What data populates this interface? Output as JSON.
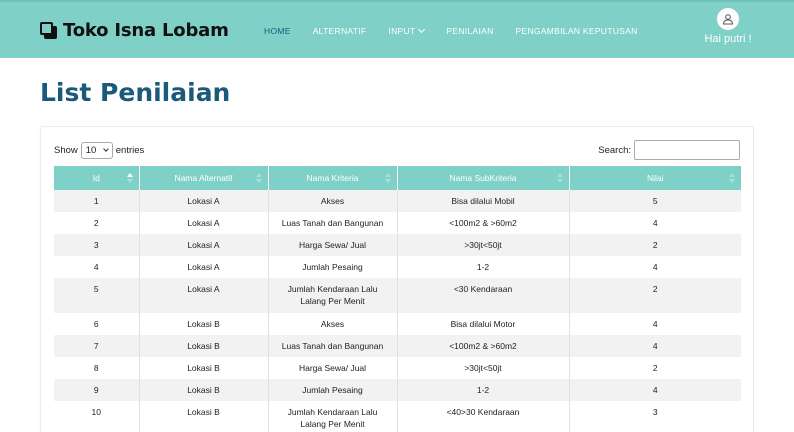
{
  "brand": {
    "name": "Toko Isna Lobam"
  },
  "nav": {
    "items": [
      {
        "label": "HOME",
        "active": true
      },
      {
        "label": "ALTERNATIF",
        "active": false
      },
      {
        "label": "INPUT",
        "active": false,
        "dropdown": true
      },
      {
        "label": "PENILAIAN",
        "active": false
      },
      {
        "label": "PENGAMBILAN KEPUTUSAN",
        "active": false
      }
    ]
  },
  "user": {
    "greeting": "Hai putri !",
    "icon": "user-icon"
  },
  "page": {
    "title": "List Penilaian"
  },
  "table_controls": {
    "show_label": "Show",
    "entries_value": "10",
    "entries_label": "entries",
    "search_label": "Search:",
    "search_value": ""
  },
  "table": {
    "columns": [
      "Id",
      "Nama Alternatif",
      "Nama Kriteria",
      "Nama SubKriteria",
      "Nilai"
    ],
    "rows": [
      [
        "1",
        "Lokasi A",
        "Akses",
        "Bisa dilalui Mobil",
        "5"
      ],
      [
        "2",
        "Lokasi A",
        "Luas Tanah dan Bangunan",
        "<100m2 & >60m2",
        "4"
      ],
      [
        "3",
        "Lokasi A",
        "Harga Sewa/ Jual",
        ">30jt<50jt",
        "2"
      ],
      [
        "4",
        "Lokasi A",
        "Jumlah Pesaing",
        "1-2",
        "4"
      ],
      [
        "5",
        "Lokasi A",
        "Jumlah Kendaraan Lalu Lalang Per Menit",
        "<30 Kendaraan",
        "2"
      ],
      [
        "6",
        "Lokasi B",
        "Akses",
        "Bisa dilalui Motor",
        "4"
      ],
      [
        "7",
        "Lokasi B",
        "Luas Tanah dan Bangunan",
        "<100m2 & >60m2",
        "4"
      ],
      [
        "8",
        "Lokasi B",
        "Harga Sewa/ Jual",
        ">30jt<50jt",
        "2"
      ],
      [
        "9",
        "Lokasi B",
        "Jumlah Pesaing",
        "1-2",
        "4"
      ],
      [
        "10",
        "Lokasi B",
        "Jumlah Kendaraan Lalu Lalang Per Menit",
        "<40>30 Kendaraan",
        "3"
      ]
    ]
  },
  "colors": {
    "accent": "#7fd1c7",
    "title": "#1b5a7a",
    "stripe": "#f2f2f2"
  }
}
